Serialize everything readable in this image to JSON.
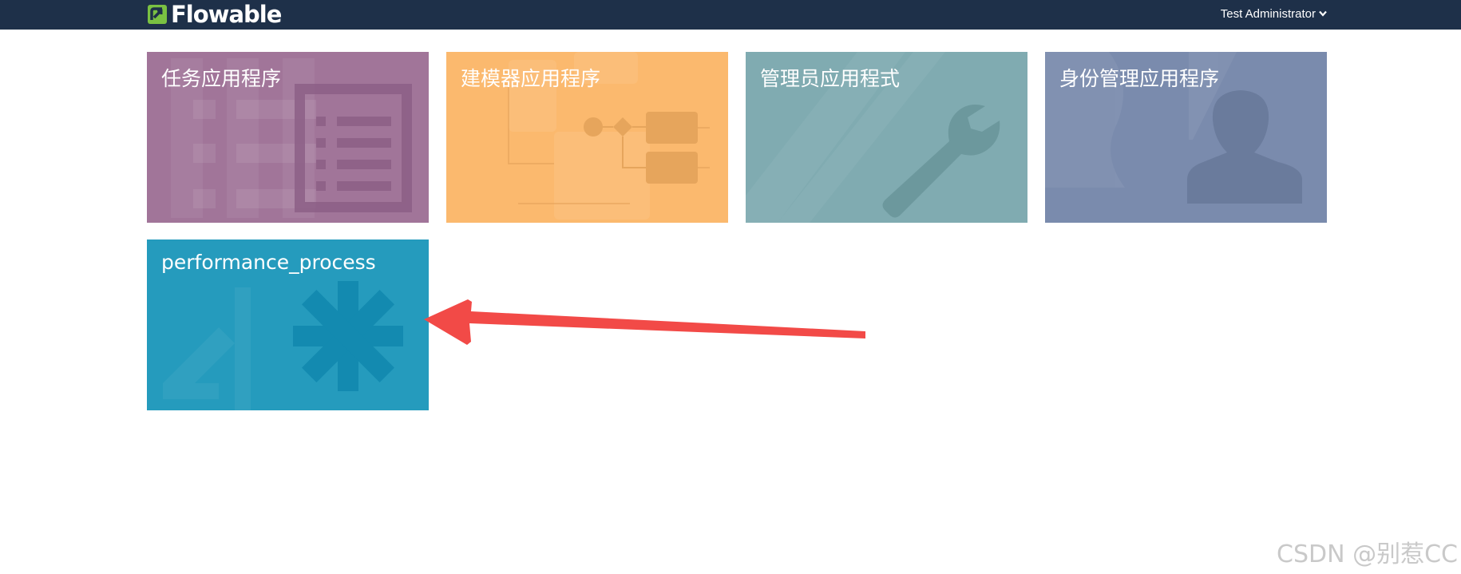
{
  "header": {
    "logo_text": "Flowable",
    "user_name": "Test Administrator",
    "logo_color": "#7ac142",
    "bar_color": "#1e3049"
  },
  "apps": [
    {
      "label": "任务应用程序",
      "icon": "task-list-icon",
      "color": "#a17599"
    },
    {
      "label": "建模器应用程序",
      "icon": "process-diagram-icon",
      "color": "#fbb96e"
    },
    {
      "label": "管理员应用程式",
      "icon": "wrench-icon",
      "color": "#80abb1"
    },
    {
      "label": "身份管理应用程序",
      "icon": "user-icon",
      "color": "#7a8bad"
    },
    {
      "label": "performance_process",
      "icon": "asterisk-icon",
      "color": "#259bbd"
    }
  ],
  "annotation": {
    "arrow_color": "#f24a47"
  },
  "watermark": "CSDN @别惹CC"
}
